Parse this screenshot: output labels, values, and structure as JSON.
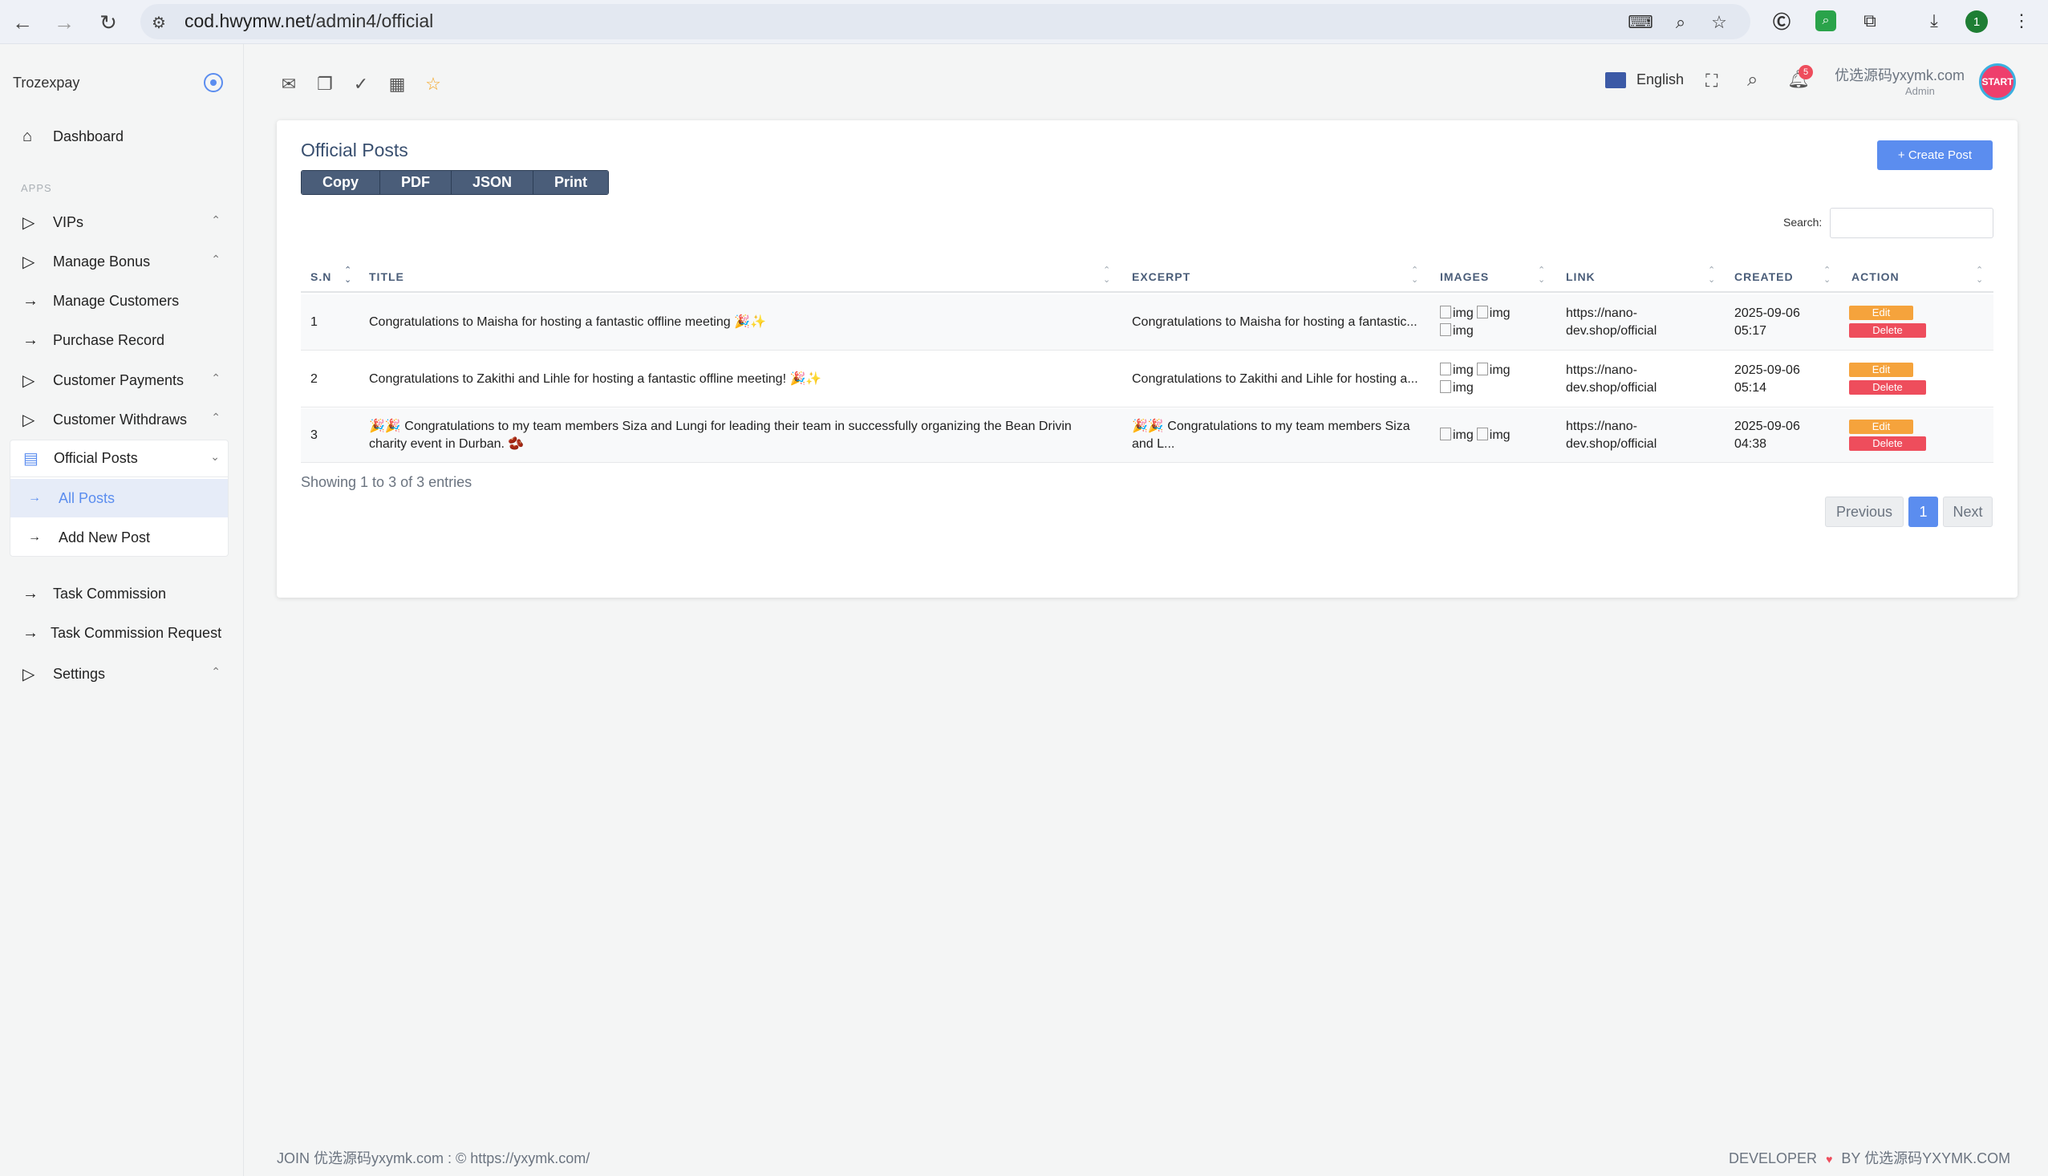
{
  "browser": {
    "url_host": "cod.hwymw.net",
    "url_path": "/admin4/official",
    "profile_initial": "1"
  },
  "sidebar": {
    "brand": "Trozexpay",
    "dashboard": "Dashboard",
    "section_label": "APPS",
    "items": [
      {
        "label": "VIPs",
        "icon": "play-outline-icon",
        "expanded": true
      },
      {
        "label": "Manage Bonus",
        "icon": "play-outline-icon",
        "expanded": true
      },
      {
        "label": "Manage Customers",
        "icon": "arrow-right-icon"
      },
      {
        "label": "Purchase Record",
        "icon": "arrow-right-icon"
      },
      {
        "label": "Customer Payments",
        "icon": "play-outline-icon",
        "expanded": true
      },
      {
        "label": "Customer Withdraws",
        "icon": "play-outline-icon",
        "expanded": true
      },
      {
        "label": "Official Posts",
        "icon": "newspaper-icon",
        "expanded": true
      },
      {
        "label": "Task Commission",
        "icon": "arrow-right-icon"
      },
      {
        "label": "Task Commission Request",
        "icon": "arrow-right-icon"
      },
      {
        "label": "Settings",
        "icon": "play-outline-icon",
        "expanded": true
      }
    ],
    "subitems": [
      {
        "label": "All Posts",
        "active": true
      },
      {
        "label": "Add New Post",
        "active": false
      }
    ]
  },
  "topbar": {
    "language": "English",
    "notification_count": "5",
    "user_name": "优选源码yxymk.com",
    "user_role": "Admin",
    "avatar_text": "START"
  },
  "card": {
    "title": "Official Posts",
    "export_buttons": [
      "Copy",
      "PDF",
      "JSON",
      "Print"
    ],
    "create_button": "+ Create Post",
    "search_label": "Search:",
    "search_value": "",
    "columns": [
      "S.N",
      "TITLE",
      "EXCERPT",
      "IMAGES",
      "LINK",
      "CREATED",
      "ACTION"
    ],
    "rows": [
      {
        "sn": "1",
        "title": "Congratulations to Maisha for hosting a fantastic offline meeting 🎉✨",
        "excerpt": "Congratulations to Maisha for hosting a fantastic...",
        "images": [
          "img",
          "img",
          "img"
        ],
        "link_line1": "https://nano-",
        "link_line2": "dev.shop/official",
        "created_date": "2025-09-06",
        "created_time": "05:17",
        "edit": "Edit",
        "delete": "Delete"
      },
      {
        "sn": "2",
        "title": "Congratulations to Zakithi and Lihle for hosting a fantastic offline meeting! 🎉✨",
        "excerpt": "Congratulations to Zakithi and Lihle for hosting a...",
        "images": [
          "img",
          "img",
          "img"
        ],
        "link_line1": "https://nano-",
        "link_line2": "dev.shop/official",
        "created_date": "2025-09-06",
        "created_time": "05:14",
        "edit": "Edit",
        "delete": "Delete"
      },
      {
        "sn": "3",
        "title_line1": "🎉🎉 Congratulations to my team members Siza and Lungi for leading their team in successfully organizing the Bean Drivin",
        "title_line2": "charity event in Durban. 🫘",
        "excerpt_line1": "🎉🎉 Congratulations to my team members Siza",
        "excerpt_line2": "and L...",
        "images": [
          "img",
          "img"
        ],
        "link_line1": "https://nano-",
        "link_line2": "dev.shop/official",
        "created_date": "2025-09-06",
        "created_time": "04:38",
        "edit": "Edit",
        "delete": "Delete"
      }
    ],
    "showing": "Showing 1 to 3 of 3 entries",
    "pager": {
      "previous": "Previous",
      "current": "1",
      "next": "Next"
    }
  },
  "footer": {
    "left": "JOIN 优选源码yxymk.com : © https://yxymk.com/",
    "right_prefix": "DEVELOPER",
    "right_suffix": "BY 优选源码YXYMK.COM"
  },
  "colors": {
    "accent": "#5b8def",
    "edit": "#f5a33c",
    "delete": "#ee4d5c",
    "export": "#4a5d79"
  }
}
